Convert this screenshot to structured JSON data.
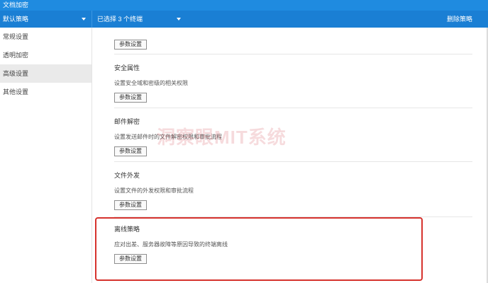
{
  "window": {
    "title": "文档加密"
  },
  "topbar": {
    "policy_select": "默认策略",
    "selected_select": "已选择 3 个终端",
    "delete_policy": "删除策略"
  },
  "sidebar": {
    "items": [
      {
        "label": "常规设置",
        "active": false
      },
      {
        "label": "透明加密",
        "active": false
      },
      {
        "label": "高级设置",
        "active": true
      },
      {
        "label": "其他设置",
        "active": false
      }
    ]
  },
  "sections": [
    {
      "title": "",
      "desc": "",
      "button": "参数设置"
    },
    {
      "title": "安全属性",
      "desc": "设置安全域和密级的相关权限",
      "button": "参数设置"
    },
    {
      "title": "邮件解密",
      "desc": "设置发送邮件时的文件解密权限和审批流程",
      "button": "参数设置"
    },
    {
      "title": "文件外发",
      "desc": "设置文件的外发权限和审批流程",
      "button": "参数设置"
    },
    {
      "title": "离线策略",
      "desc": "应对出差、服务器故障等原因导致的终端离线",
      "button": "参数设置"
    }
  ],
  "watermark": "洞察眼MIT系统",
  "colors": {
    "accent": "#1a7fd4",
    "highlight": "#d6322d"
  }
}
